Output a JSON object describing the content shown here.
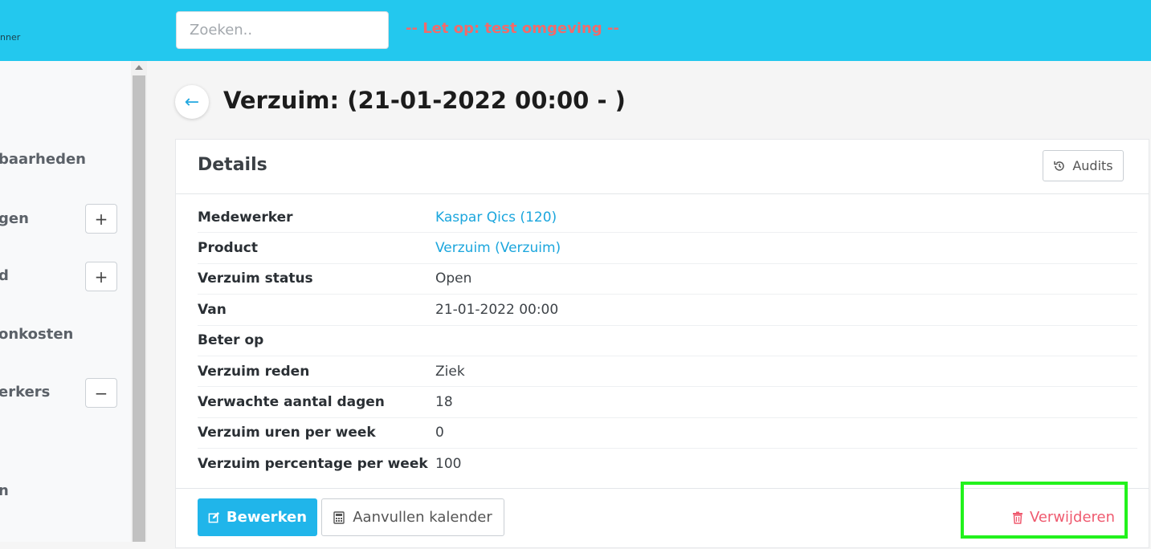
{
  "header": {
    "brand_fragment": "nner",
    "search_placeholder": "Zoeken..",
    "warning": "-- Let op: test omgeving --"
  },
  "sidebar": {
    "items": [
      {
        "label": "baarheden",
        "toggle": null
      },
      {
        "label": "gen",
        "toggle": "+"
      },
      {
        "label": "d",
        "toggle": "+"
      },
      {
        "label": "onkosten",
        "toggle": null
      },
      {
        "label": "erkers",
        "toggle": "−"
      },
      {
        "label": "n",
        "toggle": null
      }
    ]
  },
  "page": {
    "back_icon": "←",
    "title": "Verzuim: (21-01-2022 00:00 - )"
  },
  "details": {
    "title": "Details",
    "audits_label": "Audits",
    "audits_icon": "history-icon",
    "rows": [
      {
        "label": "Medewerker",
        "value": "Kaspar Qics (120)",
        "link": true
      },
      {
        "label": "Product",
        "value": "Verzuim (Verzuim)",
        "link": true
      },
      {
        "label": "Verzuim status",
        "value": "Open",
        "link": false
      },
      {
        "label": "Van",
        "value": "21-01-2022 00:00",
        "link": false
      },
      {
        "label": "Beter op",
        "value": "",
        "link": false
      },
      {
        "label": "Verzuim reden",
        "value": "Ziek",
        "link": false
      },
      {
        "label": "Verwachte aantal dagen",
        "value": "18",
        "link": false
      },
      {
        "label": "Verzuim uren per week",
        "value": "0",
        "link": false
      },
      {
        "label": "Verzuim percentage per week",
        "value": "100",
        "link": false
      }
    ]
  },
  "footer": {
    "edit_label": "Bewerken",
    "calendar_label": "Aanvullen kalender",
    "delete_label": "Verwijderen"
  },
  "colors": {
    "topbar": "#23c8ee",
    "primary": "#20b5ea",
    "link": "#1ba6dd",
    "danger": "#ef5a6f",
    "warning": "#f06b6b",
    "highlight": "#22f21c"
  }
}
